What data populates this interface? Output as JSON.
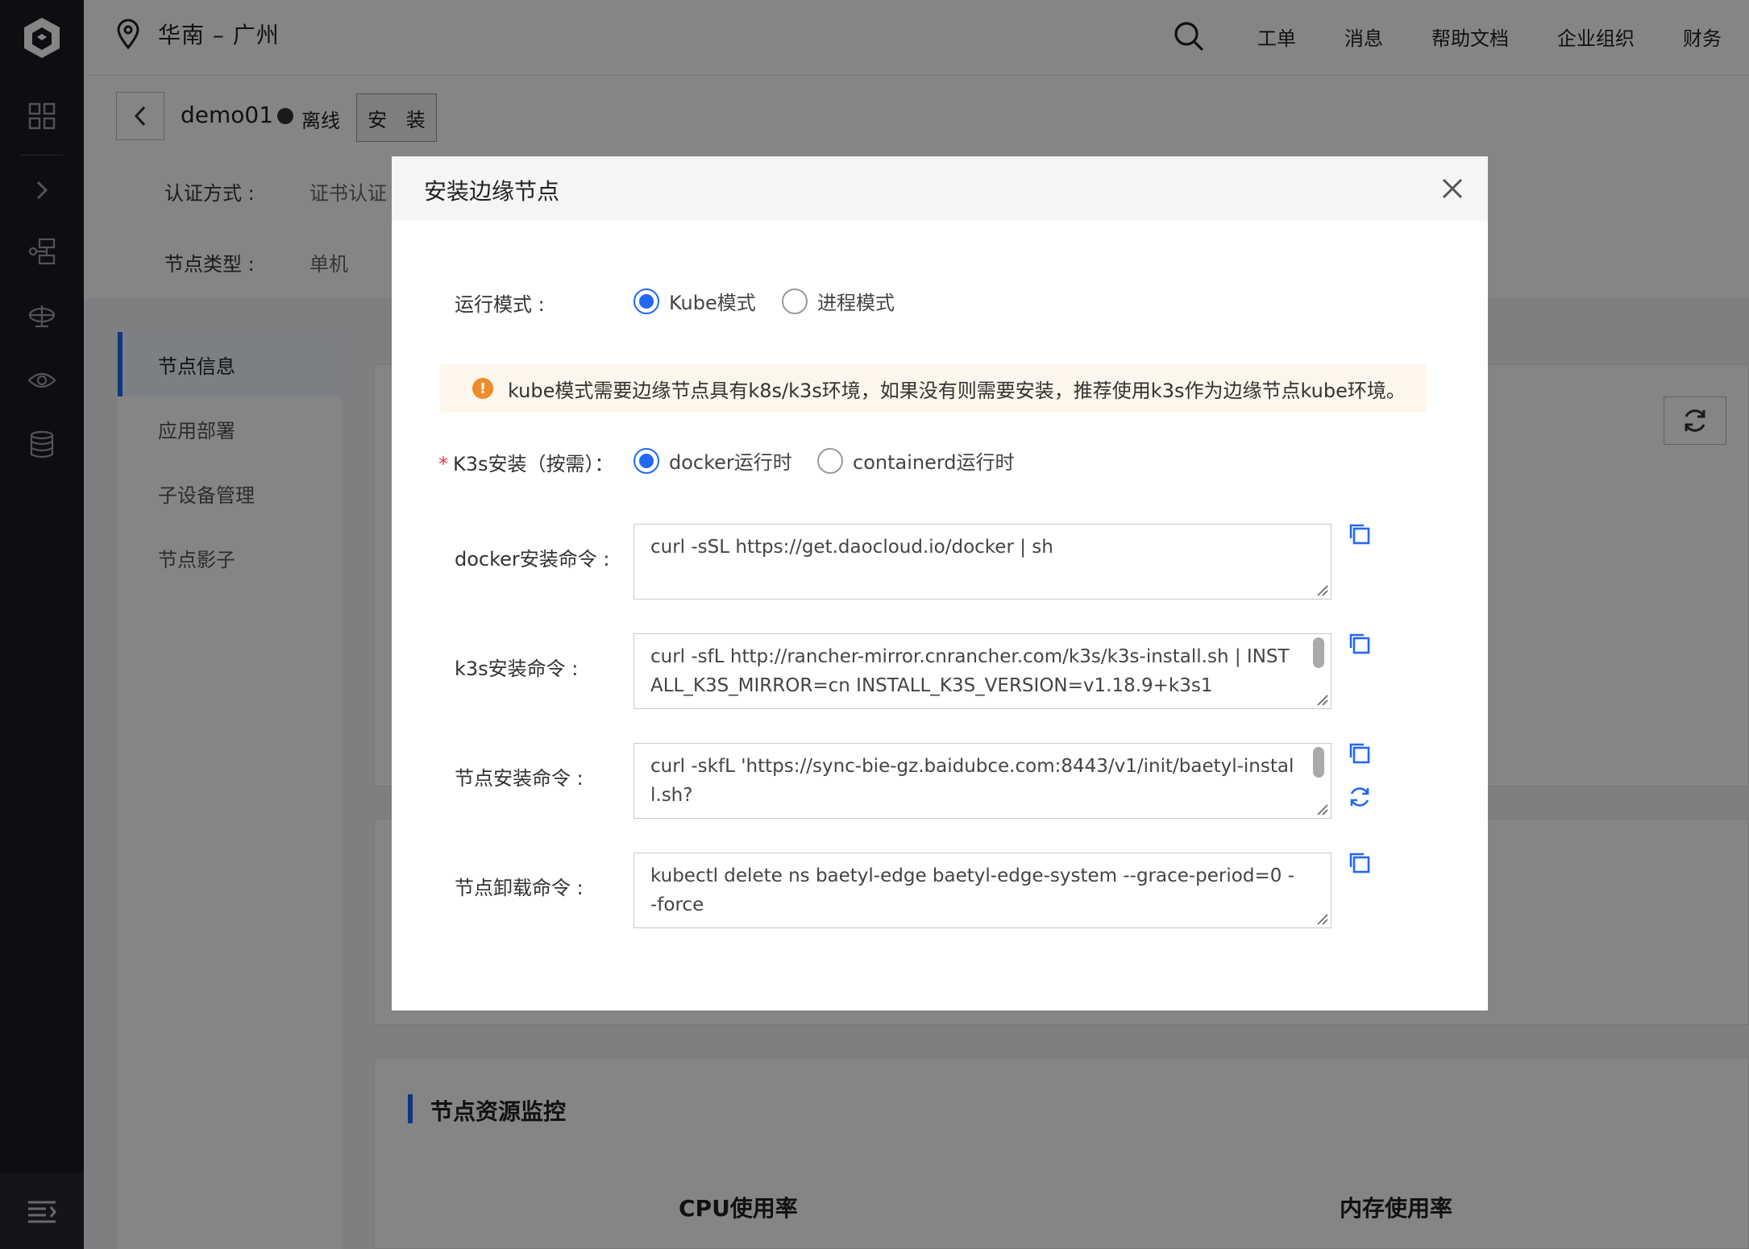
{
  "header": {
    "region": "华南 – 广州",
    "nav": [
      "工单",
      "消息",
      "帮助文档",
      "企业组织",
      "财务"
    ]
  },
  "node": {
    "name": "demo01",
    "status": "离线",
    "install_label": "安 装",
    "auth_label": "认证方式 :",
    "auth_value": "证书认证",
    "type_label": "节点类型 :",
    "type_value": "单机"
  },
  "tabs": [
    "节点信息",
    "应用部署",
    "子设备管理",
    "节点影子"
  ],
  "monitor": {
    "title": "节点资源监控",
    "cpu": "CPU使用率",
    "memory": "内存使用率"
  },
  "modal": {
    "title": "安装边缘节点",
    "run_mode_label": "运行模式 :",
    "run_modes": [
      "Kube模式",
      "进程模式"
    ],
    "alert": "kube模式需要边缘节点具有k8s/k3s环境，如果没有则需要安装，推荐使用k3s作为边缘节点kube环境。",
    "k3s_label": "K3s安装（按需）：",
    "k3s_options": [
      "docker运行时",
      "containerd运行时"
    ],
    "docker_cmd_label": "docker安装命令 :",
    "docker_cmd": "curl -sSL https://get.daocloud.io/docker | sh",
    "k3s_cmd_label": "k3s安装命令 :",
    "k3s_cmd": "curl -sfL http://rancher-mirror.cnrancher.com/k3s/k3s-install.sh | INSTALL_K3S_MIRROR=cn INSTALL_K3S_VERSION=v1.18.9+k3s1",
    "node_cmd_label": "节点安装命令 :",
    "node_cmd": "curl -skfL 'https://sync-bie-gz.baidubce.com:8443/v1/init/baetyl-install.sh?",
    "uninstall_cmd_label": "节点卸载命令 :",
    "uninstall_cmd": "kubectl delete ns baetyl-edge baetyl-edge-system --grace-period=0 --force"
  },
  "colors": {
    "primary": "#2468f2",
    "warning": "#f08b2c",
    "sidebar": "#1a1c22"
  }
}
